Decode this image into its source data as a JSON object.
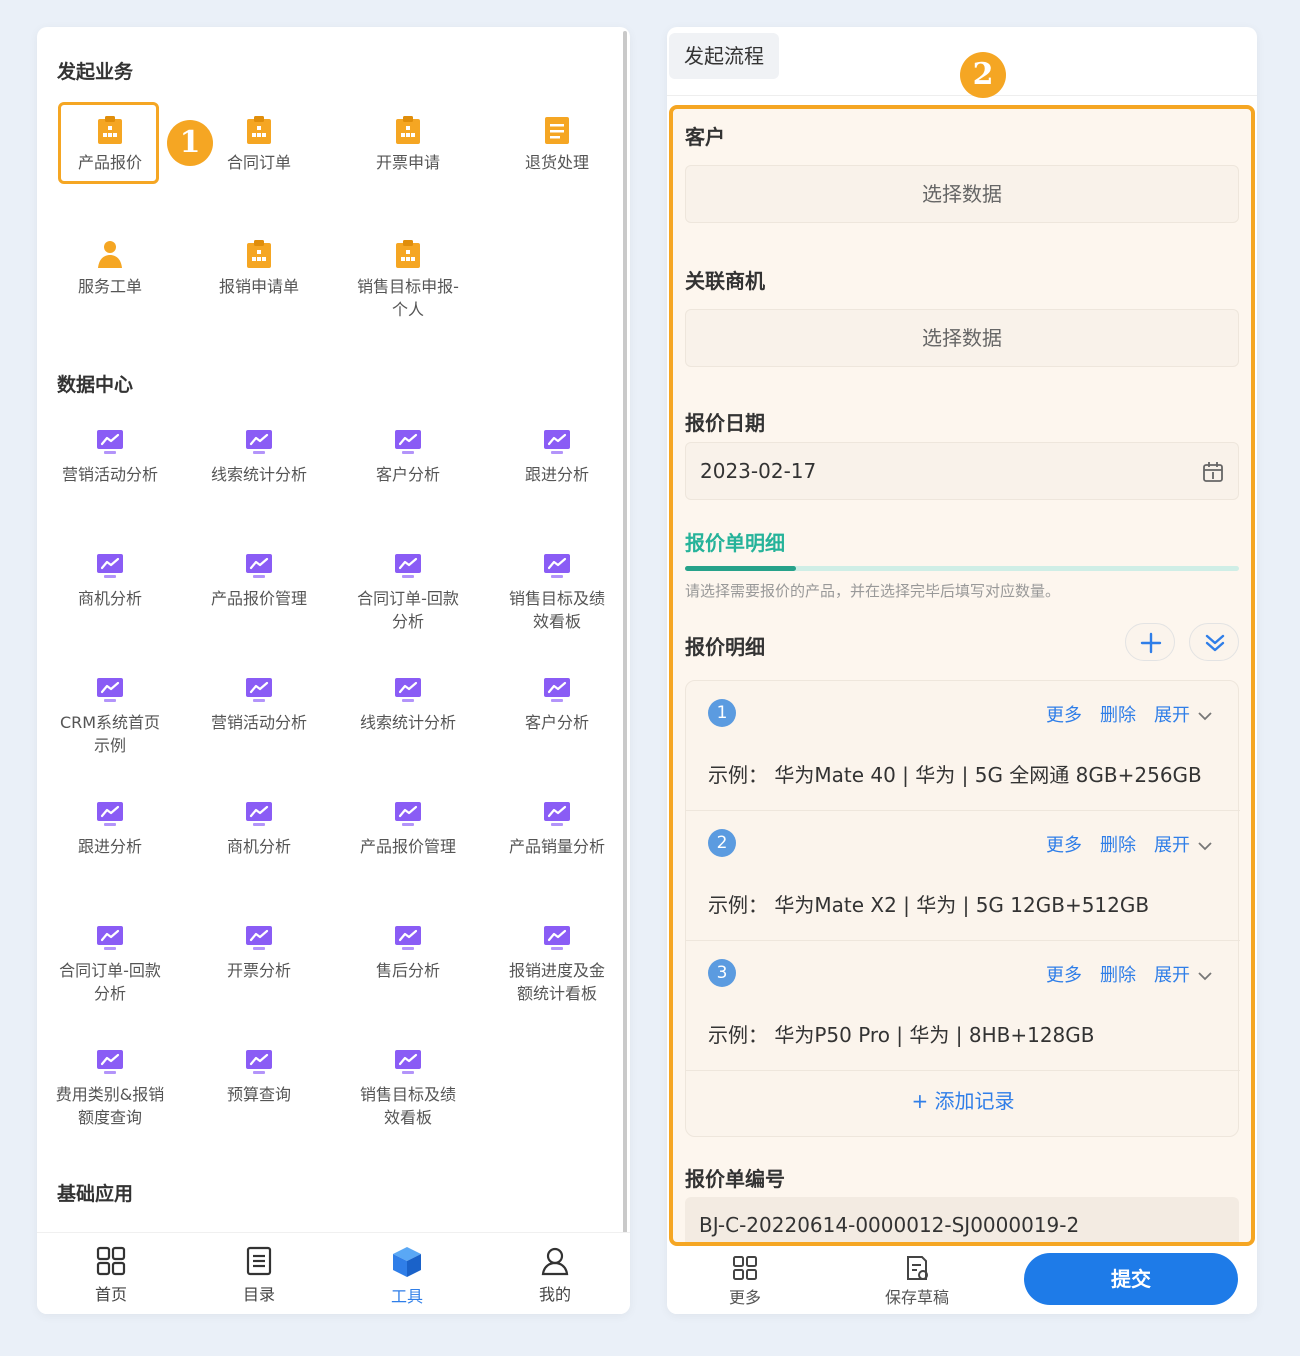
{
  "left": {
    "sections": {
      "business": "发起业务",
      "data_center": "数据中心",
      "basic_apps": "基础应用"
    },
    "business_items": [
      "产品报价",
      "合同订单",
      "开票申请",
      "退货处理",
      "服务工单",
      "报销申请单",
      "销售目标申报-\n个人"
    ],
    "data_items": [
      "营销活动分析",
      "线索统计分析",
      "客户分析",
      "跟进分析",
      "商机分析",
      "产品报价管理",
      "合同订单-回款\n分析",
      "销售目标及绩\n效看板",
      "CRM系统首页\n示例",
      "营销活动分析",
      "线索统计分析",
      "客户分析",
      "跟进分析",
      "商机分析",
      "产品报价管理",
      "产品销量分析",
      "合同订单-回款\n分析",
      "开票分析",
      "售后分析",
      "报销进度及金\n额统计看板",
      "费用类别&报销\n额度查询",
      "预算查询",
      "销售目标及绩\n效看板"
    ],
    "badge": "1",
    "tabbar": [
      "首页",
      "目录",
      "工具",
      "我的"
    ]
  },
  "right": {
    "header_tab": "发起流程",
    "badge": "2",
    "fields": {
      "customer_label": "客户",
      "customer_placeholder": "选择数据",
      "opportunity_label": "关联商机",
      "opportunity_placeholder": "选择数据",
      "date_label": "报价日期",
      "date_value": "2023-02-17",
      "detail_section": "报价单明细",
      "detail_hint": "请选择需要报价的产品，并在选择完毕后填写对应数量。",
      "detail_list_label": "报价明细",
      "code_label": "报价单编号",
      "code_value": "BJ-C-20220614-0000012-SJ0000019-2"
    },
    "progress": 0.2,
    "records": [
      {
        "num": "1",
        "desc": "示例：  华为Mate 40 | 华为 | 5G 全网通 8GB+256GB"
      },
      {
        "num": "2",
        "desc": "示例：  华为Mate X2 | 华为 | 5G 12GB+512GB"
      },
      {
        "num": "3",
        "desc": "示例：  华为P50 Pro | 华为 | 8HB+128GB"
      }
    ],
    "record_actions": {
      "more": "更多",
      "delete": "删除",
      "expand": "展开"
    },
    "add_record": "+ 添加记录",
    "bottom": {
      "more": "更多",
      "save_draft": "保存草稿",
      "submit": "提交"
    }
  },
  "colors": {
    "orange_accent": "#f5a623",
    "purple_icon": "#8a5cf5",
    "blue_primary": "#1e7be8",
    "teal": "#26b39a"
  }
}
